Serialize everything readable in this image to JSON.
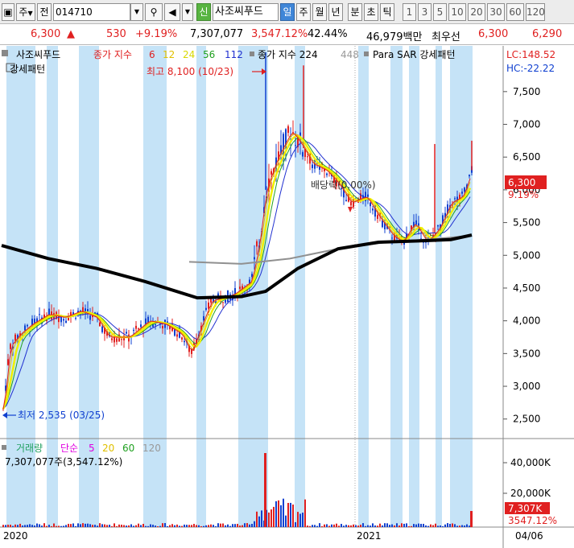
{
  "toolbar": {
    "mode": "주",
    "type": "전",
    "code": "014710",
    "badge": "신",
    "name": "사조씨푸드",
    "periods": [
      "일",
      "주",
      "월",
      "년",
      "분",
      "초",
      "틱"
    ],
    "active_period": "일",
    "numbers": [
      "1",
      "3",
      "5",
      "10",
      "20",
      "30",
      "60",
      "120"
    ]
  },
  "quote": {
    "price": "6,300",
    "change": "530",
    "rate": "+9.19%",
    "volume": "7,307,077",
    "vol_rate": "3,547.12%",
    "turnover": "42.44%",
    "amount": "46,979백만",
    "label": "최우선",
    "best_ask": "6,300",
    "best_bid": "6,290"
  },
  "legend": {
    "stock": "사조씨푸드",
    "ma_title": "종가 지수",
    "ma_periods": [
      "6",
      "12",
      "24",
      "56",
      "112"
    ],
    "long_ma_title": "종가 지수 224",
    "long_ma_extra": "448",
    "sar": "Para SAR 강세패턴",
    "sub": "강세패턴"
  },
  "annotations": {
    "high": "최고 8,100 (10/23)",
    "low": "최저 2,535 (03/25)",
    "baerak": "배당락(0.00%)",
    "lc": "LC:148.52",
    "hc": "HC:-22.22",
    "price_tag": "6,300",
    "rate_tag": "9.19%"
  },
  "price_axis": [
    "7,500",
    "7,000",
    "6,500",
    "6,000",
    "5,500",
    "5,000",
    "4,500",
    "4,000",
    "3,500",
    "3,000",
    "2,500"
  ],
  "volume_legend": {
    "title": "거래량",
    "ma_title": "단순",
    "ma_periods": [
      "5",
      "20",
      "60",
      "120"
    ],
    "value": "7,307,077주(3,547.12%)"
  },
  "volume_axis": [
    "40,000K",
    "20,000K"
  ],
  "volume_tags": {
    "vol": "7,307K",
    "rate": "3547.12%"
  },
  "date_axis": [
    "2020",
    "2021",
    "04/06"
  ],
  "colors": {
    "ma6": "#e02020",
    "ma12": "#e0c000",
    "ma24": "#f0f000",
    "ma56": "#20a020",
    "ma112": "#2030d0",
    "ma224": "#000000",
    "ma448": "#909090",
    "sar": "#e000e0",
    "band": "#c5e3f7",
    "up": "#e02020",
    "down": "#1040d0"
  },
  "chart_data": {
    "type": "candlestick",
    "ylim": [
      2300,
      8100
    ],
    "x": [
      "2020",
      "2021",
      "04/06"
    ],
    "series": [
      {
        "name": "종가 지수 224",
        "values": [
          5150,
          4900,
          4600,
          4350,
          4350,
          4700,
          5050,
          5200,
          5300
        ]
      },
      {
        "name": "종가 지수 6",
        "values": [
          2535,
          4000,
          4050,
          3700,
          3900,
          4400,
          7000,
          5800,
          5100,
          6300
        ]
      }
    ]
  }
}
